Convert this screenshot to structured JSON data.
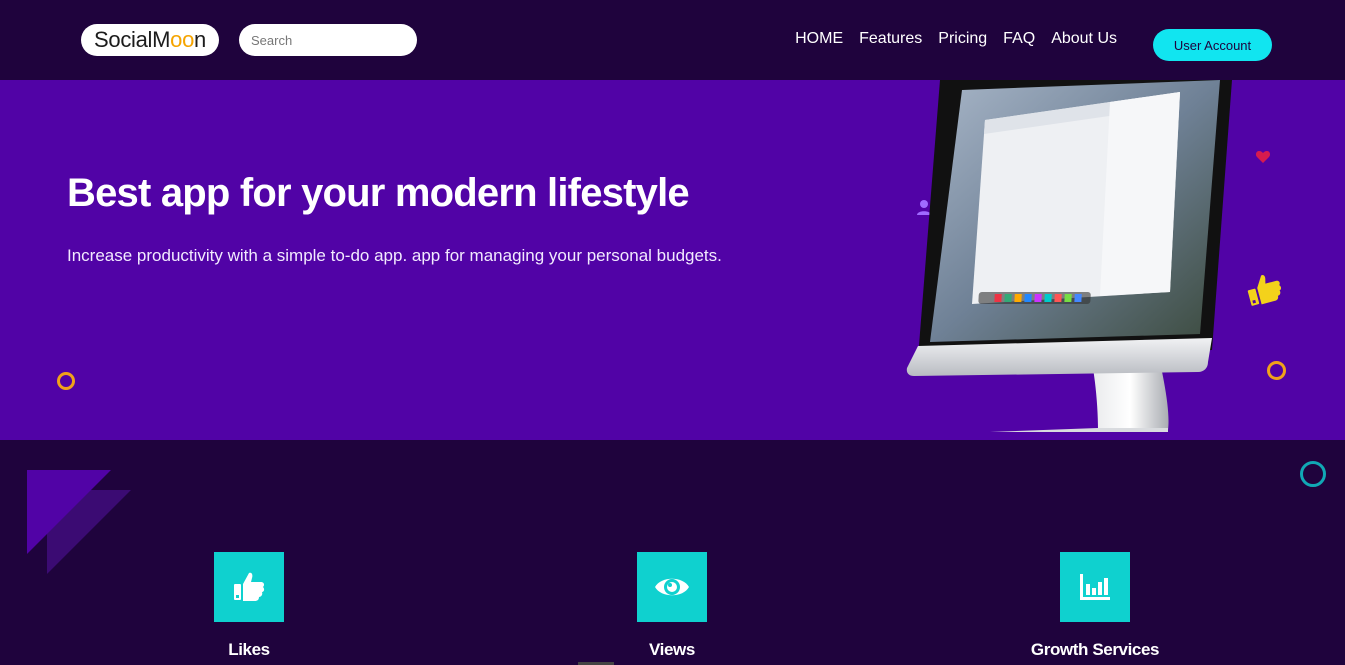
{
  "header": {
    "logo_text_prefix": "SocialM",
    "logo_text_oo": "oo",
    "logo_text_suffix": "n",
    "search_placeholder": "Search",
    "nav": [
      "HOME",
      "Features",
      "Pricing",
      "FAQ",
      "About Us"
    ],
    "account_button": "User Account"
  },
  "hero": {
    "title": "Best app for your modern lifestyle",
    "subtitle": "Increase productivity with a simple to-do app. app for managing your personal budgets."
  },
  "features": [
    {
      "label": "Likes",
      "icon": "thumbs-up-icon"
    },
    {
      "label": "Views",
      "icon": "eye-icon"
    },
    {
      "label": "Growth Services",
      "icon": "bar-chart-icon"
    }
  ],
  "colors": {
    "header_bg": "#1f033d",
    "hero_bg": "#5103a6",
    "accent_cyan": "#11e5f0",
    "feature_box": "#0fd1cf",
    "logo_accent": "#f5a400"
  }
}
